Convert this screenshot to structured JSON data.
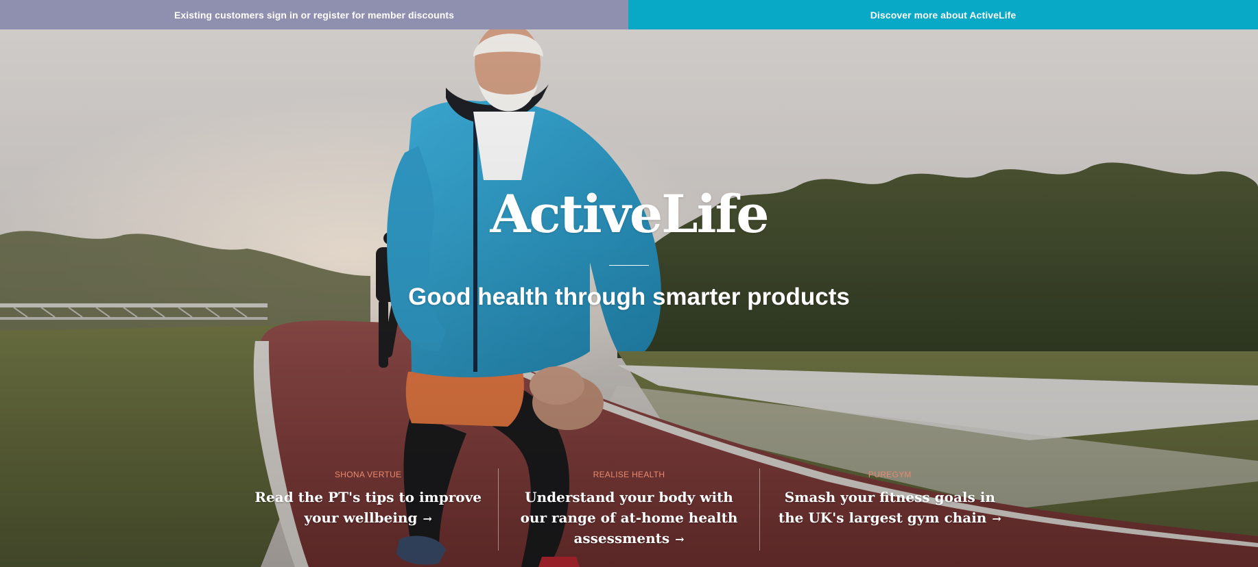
{
  "topbar": {
    "signin_label": "Existing customers sign in or register for member discounts",
    "discover_label": "Discover more about ActiveLife"
  },
  "hero": {
    "title": "ActiveLife",
    "tagline": "Good health through smarter products"
  },
  "cards": [
    {
      "source": "SHONA VERTUE",
      "headline": "Read the PT's tips to improve your wellbeing",
      "arrow": "→"
    },
    {
      "source": "REALISE HEALTH",
      "headline": "Understand your body with our range of at-home health assessments",
      "arrow": "→"
    },
    {
      "source": "PUREGYM",
      "headline": "Smash your fitness goals in the UK's largest gym chain",
      "arrow": "→"
    }
  ],
  "colors": {
    "signin_bar": "#8f8fb0",
    "discover_bar": "#08a9c6",
    "card_source": "#e98a6e"
  }
}
